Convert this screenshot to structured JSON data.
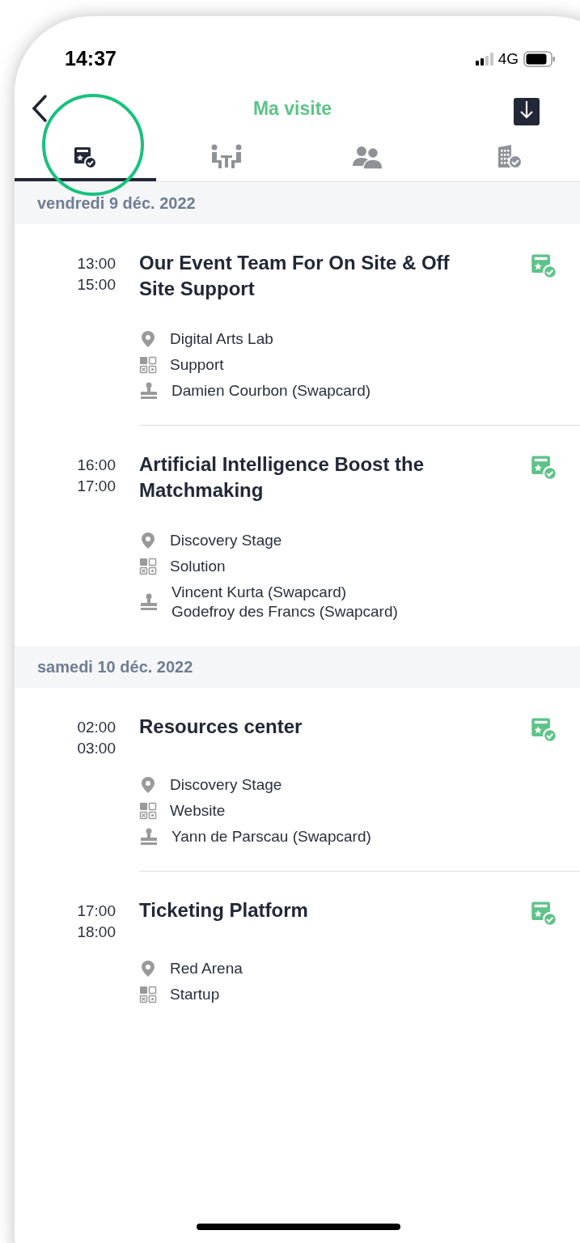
{
  "status_bar": {
    "time": "14:37",
    "network": "4G"
  },
  "header": {
    "title": "Ma visite"
  },
  "tabs": [
    {
      "kind": "agenda",
      "selected": true
    },
    {
      "kind": "meetings",
      "selected": false
    },
    {
      "kind": "people",
      "selected": false
    },
    {
      "kind": "exhibitors",
      "selected": false
    }
  ],
  "days": [
    {
      "date": "vendredi 9 déc. 2022",
      "sessions": [
        {
          "start": "13:00",
          "end": "15:00",
          "title": "Our Event Team For On Site & Off Site Support",
          "details": [
            {
              "kind": "location",
              "lines": [
                "Digital Arts Lab"
              ]
            },
            {
              "kind": "category",
              "lines": [
                "Support"
              ]
            },
            {
              "kind": "speakers",
              "lines": [
                "Damien Courbon (Swapcard)"
              ]
            }
          ]
        },
        {
          "start": "16:00",
          "end": "17:00",
          "title": "Artificial Intelligence Boost the Matchmaking",
          "details": [
            {
              "kind": "location",
              "lines": [
                "Discovery Stage"
              ]
            },
            {
              "kind": "category",
              "lines": [
                "Solution"
              ]
            },
            {
              "kind": "speakers",
              "lines": [
                "Vincent Kurta (Swapcard)",
                "Godefroy des Francs (Swapcard)"
              ]
            }
          ]
        }
      ]
    },
    {
      "date": "samedi 10 déc. 2022",
      "sessions": [
        {
          "start": "02:00",
          "end": "03:00",
          "title": "Resources center",
          "details": [
            {
              "kind": "location",
              "lines": [
                "Discovery Stage"
              ]
            },
            {
              "kind": "category",
              "lines": [
                "Website"
              ]
            },
            {
              "kind": "speakers",
              "lines": [
                "Yann de Parscau (Swapcard)"
              ]
            }
          ]
        },
        {
          "start": "17:00",
          "end": "18:00",
          "title": "Ticketing Platform",
          "details": [
            {
              "kind": "location",
              "lines": [
                "Red Arena"
              ]
            },
            {
              "kind": "category",
              "lines": [
                "Startup"
              ]
            }
          ]
        }
      ]
    }
  ]
}
